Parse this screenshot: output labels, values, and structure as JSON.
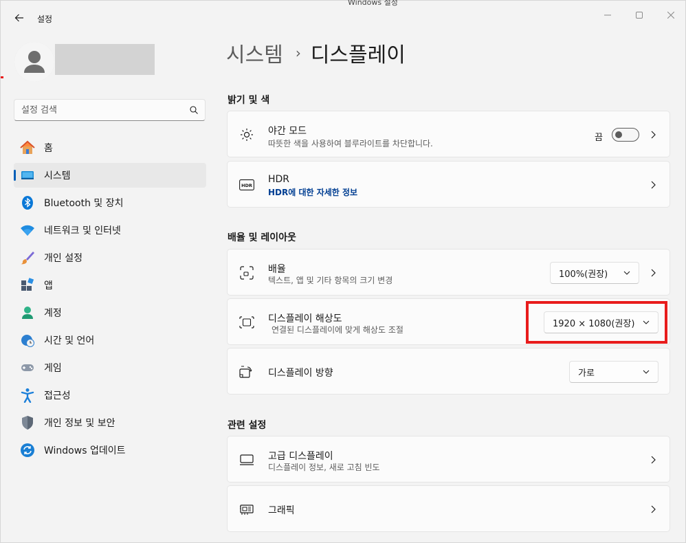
{
  "window": {
    "title": "설정",
    "top_cut_text": "Windows 설정"
  },
  "search": {
    "placeholder": "설정 검색"
  },
  "sidebar": {
    "items": [
      {
        "label": "홈",
        "icon": "home-icon"
      },
      {
        "label": "시스템",
        "icon": "system-icon",
        "active": true
      },
      {
        "label": "Bluetooth 및 장치",
        "icon": "bluetooth-icon"
      },
      {
        "label": "네트워크 및 인터넷",
        "icon": "wifi-icon"
      },
      {
        "label": "개인 설정",
        "icon": "brush-icon"
      },
      {
        "label": "앱",
        "icon": "apps-icon"
      },
      {
        "label": "계정",
        "icon": "account-icon"
      },
      {
        "label": "시간 및 언어",
        "icon": "clock-globe-icon"
      },
      {
        "label": "게임",
        "icon": "gamepad-icon"
      },
      {
        "label": "접근성",
        "icon": "accessibility-icon"
      },
      {
        "label": "개인 정보 및 보안",
        "icon": "shield-icon"
      },
      {
        "label": "Windows 업데이트",
        "icon": "update-icon"
      }
    ]
  },
  "breadcrumb": {
    "parent": "시스템",
    "separator": "›",
    "current": "디스플레이"
  },
  "sections": {
    "brightness": "밝기 및 색",
    "scale_layout": "배율 및 레이아웃",
    "related": "관련 설정"
  },
  "cards": {
    "night_light": {
      "title": "야간 모드",
      "subtitle": "따뜻한 색을 사용하여 블루라이트를 차단합니다.",
      "toggle_state": "끔"
    },
    "hdr": {
      "title": "HDR",
      "link": "HDR에 대한 자세한 정보"
    },
    "scale": {
      "title": "배율",
      "subtitle": "텍스트, 앱 및 기타 항목의 크기 변경",
      "value": "100%(권장)"
    },
    "resolution": {
      "title": "디스플레이 해상도",
      "subtitle": "연결된 디스플레이에 맞게 해상도 조절",
      "value": "1920 × 1080(권장)"
    },
    "orientation": {
      "title": "디스플레이 방향",
      "value": "가로"
    },
    "advanced": {
      "title": "고급 디스플레이",
      "subtitle": "디스플레이 정보, 새로 고침 빈도"
    },
    "graphics": {
      "title": "그래픽"
    }
  },
  "colors": {
    "accent": "#005fb8",
    "highlight": "#e81c1c",
    "link": "#003e92"
  }
}
